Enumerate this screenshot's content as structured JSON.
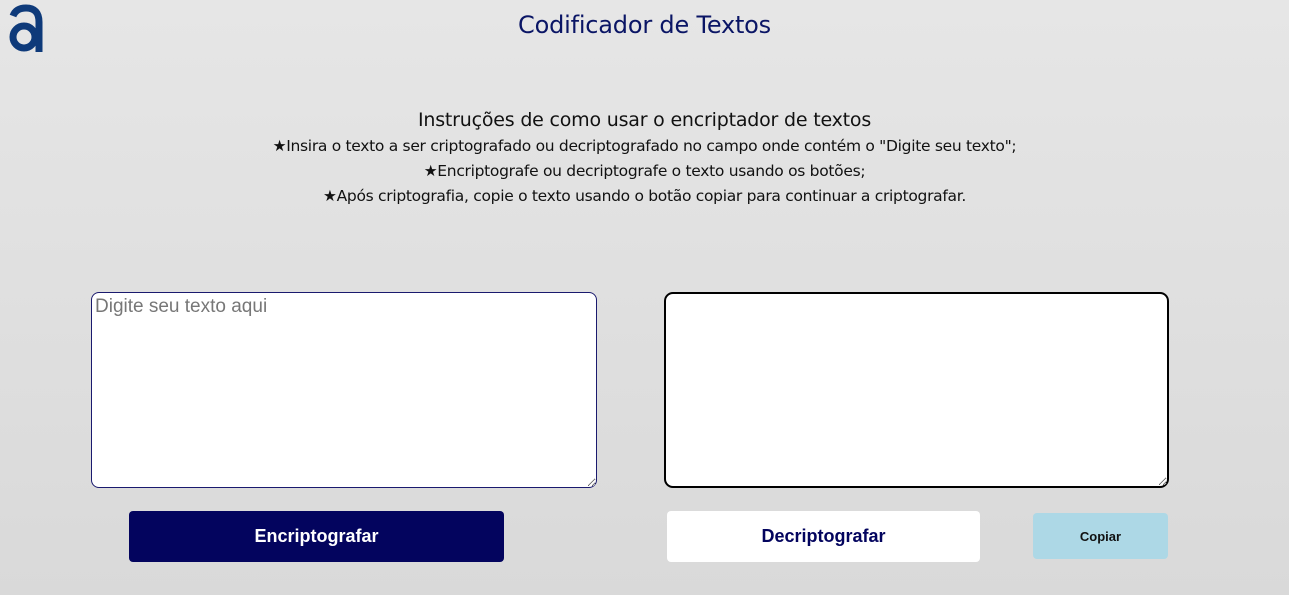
{
  "header": {
    "logo_icon": "alura-a-logo-icon",
    "logo_color": "#0e3a7a",
    "title": "Codificador de Textos",
    "title_color": "#0a1565"
  },
  "instructions": {
    "title": "Instruções de como usar o encriptador de textos",
    "lines": [
      "★Insira o texto a ser criptografado ou decriptografado no campo onde contém o \"Digite seu texto\";",
      "★Encriptografe ou decriptografe o texto usando os botões;",
      "★Após criptografia, copie o texto usando o botão copiar para continuar a criptografar."
    ]
  },
  "input": {
    "placeholder": "Digite seu texto aqui",
    "value": ""
  },
  "output": {
    "value": ""
  },
  "buttons": {
    "encrypt_label": "Encriptografar",
    "decrypt_label": "Decriptografar",
    "copy_label": "Copiar",
    "encrypt_bg": "#03045e",
    "decrypt_bg": "#ffffff",
    "copy_bg": "#add8e6"
  }
}
